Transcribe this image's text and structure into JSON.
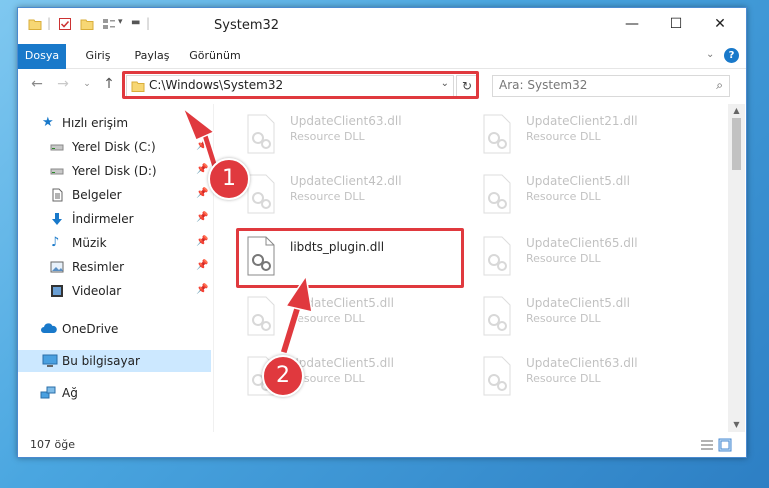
{
  "window": {
    "title": "System32",
    "minimize": "—",
    "maximize": "☐",
    "close": "✕"
  },
  "ribbon": {
    "tabs": [
      "Dosya",
      "Giriş",
      "Paylaş",
      "Görünüm"
    ],
    "help": "?"
  },
  "address": {
    "path": "C:\\Windows\\System32",
    "search_placeholder": "Ara: System32"
  },
  "sidebar": {
    "items": [
      {
        "label": "Hızlı erişim",
        "icon": "star-icon"
      },
      {
        "label": "Yerel Disk (C:)",
        "icon": "drive-icon",
        "pinned": true
      },
      {
        "label": "Yerel Disk (D:)",
        "icon": "drive-icon",
        "pinned": true
      },
      {
        "label": "Belgeler",
        "icon": "document-icon",
        "pinned": true
      },
      {
        "label": "İndirmeler",
        "icon": "download-icon",
        "pinned": true
      },
      {
        "label": "Müzik",
        "icon": "music-icon",
        "pinned": true
      },
      {
        "label": "Resimler",
        "icon": "pictures-icon",
        "pinned": true
      },
      {
        "label": "Videolar",
        "icon": "video-icon",
        "pinned": true
      },
      {
        "label": "OneDrive",
        "icon": "cloud-icon"
      },
      {
        "label": "Bu bilgisayar",
        "icon": "computer-icon",
        "selected": true
      },
      {
        "label": "Ağ",
        "icon": "network-icon"
      }
    ]
  },
  "files": [
    {
      "name": "UpdateClient63.dll",
      "type": "Resource DLL"
    },
    {
      "name": "UpdateClient21.dll",
      "type": "Resource DLL"
    },
    {
      "name": "UpdateClient42.dll",
      "type": "Resource DLL"
    },
    {
      "name": "UpdateClient5.dll",
      "type": "Resource DLL"
    },
    {
      "name": "libdts_plugin.dll",
      "type": ""
    },
    {
      "name": "UpdateClient65.dll",
      "type": "Resource DLL"
    },
    {
      "name": "UpdateClient5.dll",
      "type": "Resource DLL"
    },
    {
      "name": "UpdateClient5.dll",
      "type": "Resource DLL"
    },
    {
      "name": "UpdateClient5.dll",
      "type": "Resource DLL"
    },
    {
      "name": "UpdateClient63.dll",
      "type": "Resource DLL"
    }
  ],
  "status": {
    "item_count": "107 öğe"
  },
  "markers": [
    "1",
    "2"
  ],
  "colors": {
    "accent": "#1979ca",
    "highlight": "#e0393e",
    "selected": "#cce8ff"
  }
}
